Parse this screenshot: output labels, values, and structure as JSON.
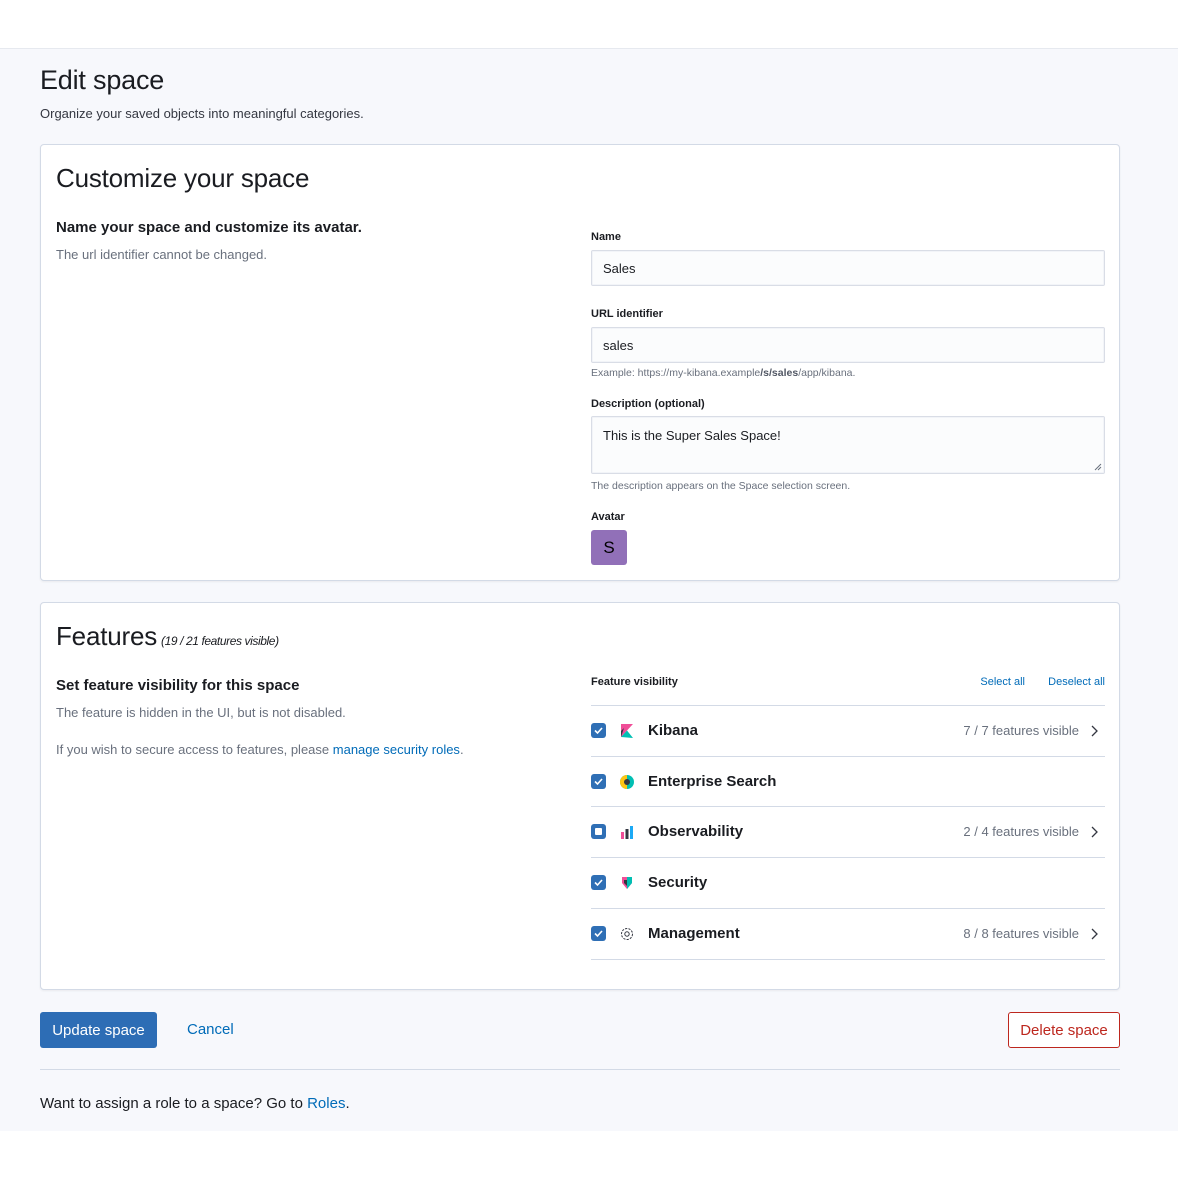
{
  "page": {
    "title": "Edit space",
    "subtitle": "Organize your saved objects into meaningful categories."
  },
  "customize": {
    "title": "Customize your space",
    "desc_title": "Name your space and customize its avatar.",
    "desc_text": "The url identifier cannot be changed.",
    "name_label": "Name",
    "name_value": "Sales",
    "url_label": "URL identifier",
    "url_value": "sales",
    "url_help_prefix": "Example: https://my-kibana.example",
    "url_help_bold": "/s/sales",
    "url_help_suffix": "/app/kibana.",
    "description_label": "Description (optional)",
    "description_value": "This is the Super Sales Space!",
    "description_help": "The description appears on the Space selection screen.",
    "avatar_label": "Avatar",
    "avatar_initial": "S",
    "avatar_color": "#9170b8"
  },
  "features": {
    "title": "Features",
    "count": "(19 / 21 features visible)",
    "desc_title": "Set feature visibility for this space",
    "desc_text": "The feature is hidden in the UI, but is not disabled.",
    "secure_prefix": "If you wish to secure access to features, please ",
    "secure_link": "manage security roles",
    "secure_suffix": ".",
    "visibility_label": "Feature visibility",
    "select_all": "Select all",
    "deselect_all": "Deselect all",
    "rows": [
      {
        "name": "Kibana",
        "count": "7 / 7 features visible",
        "state": "checked",
        "icon": "kibana-logo-icon"
      },
      {
        "name": "Enterprise Search",
        "count": "",
        "state": "checked",
        "icon": "enterprise-search-logo-icon"
      },
      {
        "name": "Observability",
        "count": "2 / 4 features visible",
        "state": "indeterminate",
        "icon": "observability-logo-icon"
      },
      {
        "name": "Security",
        "count": "",
        "state": "checked",
        "icon": "security-logo-icon"
      },
      {
        "name": "Management",
        "count": "8 / 8 features visible",
        "state": "checked",
        "icon": "gear-icon"
      }
    ]
  },
  "actions": {
    "update": "Update space",
    "cancel": "Cancel",
    "delete": "Delete space"
  },
  "footer": {
    "prefix": "Want to assign a role to a space? Go to ",
    "link": "Roles",
    "suffix": "."
  },
  "colors": {
    "primary": "#2d6db5",
    "link": "#006bb8",
    "danger": "#bd271e"
  }
}
